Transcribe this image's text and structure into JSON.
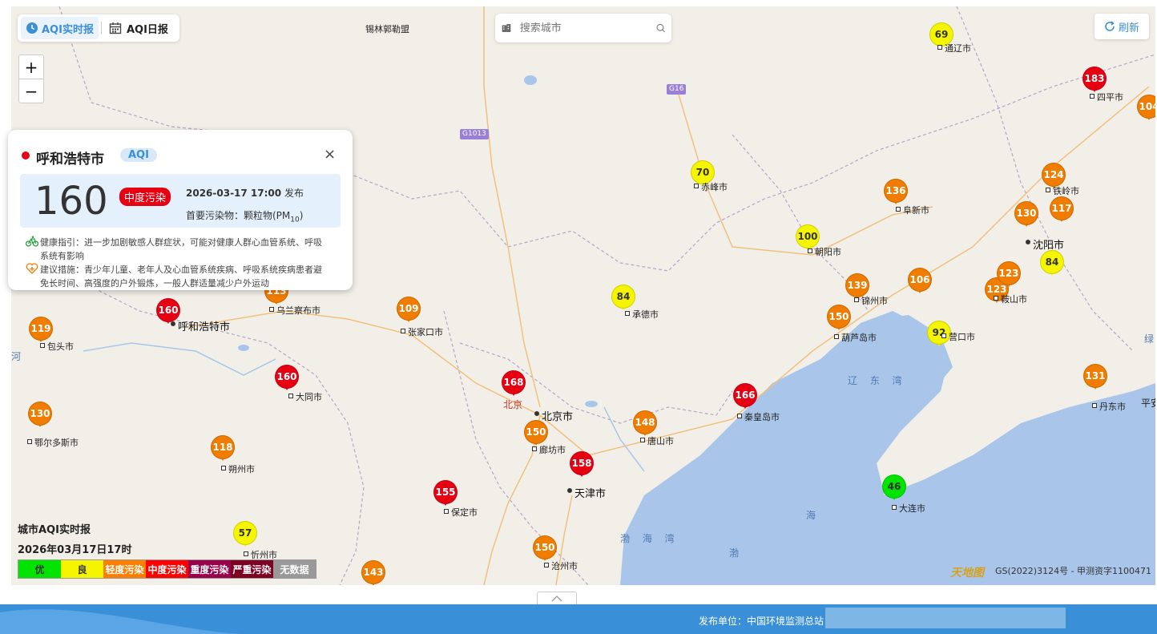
{
  "toolbar": {
    "realtime_tab": "AQI实时报",
    "daily_tab": "AQI日报",
    "search_placeholder": "搜索城市",
    "refresh_label": "刷新",
    "zoom_in": "+",
    "zoom_out": "−"
  },
  "popup": {
    "city": "呼和浩特市",
    "badge": "AQI",
    "close": "×",
    "aqi": "160",
    "level": "中度污染",
    "time": "2026-03-17 17:00",
    "publish_suffix": "发布",
    "pollutant_label": "首要污染物：颗粒物(PM",
    "pollutant_sub": "10",
    "pollutant_tail": ")",
    "health_label": "健康指引：",
    "health_text": "进一步加剧敏感人群症状，可能对健康人群心血管系统、呼吸系统有影响",
    "advice_label": "建议措施：",
    "advice_text": "青少年儿童、老年人及心血管系统疾病、呼吸系统疾病患者避免长时间、高强度的户外锻炼，一般人群适量减少户外运动"
  },
  "markers": [
    {
      "value": "69",
      "color": "#f5f500",
      "text": "#333"
    },
    {
      "value": "183",
      "color": "#e60012",
      "text": "#fff"
    },
    {
      "value": "104",
      "color": "#f07c00",
      "text": "#fff"
    },
    {
      "value": "70",
      "color": "#f5f500",
      "text": "#333"
    },
    {
      "value": "136",
      "color": "#f07c00",
      "text": "#fff"
    },
    {
      "value": "124",
      "color": "#f07c00",
      "text": "#fff"
    },
    {
      "value": "130",
      "color": "#f07c00",
      "text": "#fff"
    },
    {
      "value": "117",
      "color": "#f07c00",
      "text": "#fff"
    },
    {
      "value": "100",
      "color": "#f5f500",
      "text": "#333"
    },
    {
      "value": "84",
      "color": "#f5f500",
      "text": "#333"
    },
    {
      "value": "123",
      "color": "#f07c00",
      "text": "#fff"
    },
    {
      "value": "123",
      "color": "#f07c00",
      "text": "#fff"
    },
    {
      "value": "139",
      "color": "#f07c00",
      "text": "#fff"
    },
    {
      "value": "106",
      "color": "#f07c00",
      "text": "#fff"
    },
    {
      "value": "84",
      "color": "#f5f500",
      "text": "#333"
    },
    {
      "value": "113",
      "color": "#f07c00",
      "text": "#fff"
    },
    {
      "value": "109",
      "color": "#f07c00",
      "text": "#fff"
    },
    {
      "value": "160",
      "color": "#e60012",
      "text": "#fff"
    },
    {
      "value": "119",
      "color": "#f07c00",
      "text": "#fff"
    },
    {
      "value": "150",
      "color": "#f07c00",
      "text": "#fff"
    },
    {
      "value": "92",
      "color": "#f5f500",
      "text": "#333"
    },
    {
      "value": "160",
      "color": "#e60012",
      "text": "#fff"
    },
    {
      "value": "168",
      "color": "#e60012",
      "text": "#fff"
    },
    {
      "value": "166",
      "color": "#e60012",
      "text": "#fff"
    },
    {
      "value": "131",
      "color": "#f07c00",
      "text": "#fff"
    },
    {
      "value": "130",
      "color": "#f07c00",
      "text": "#fff"
    },
    {
      "value": "148",
      "color": "#f07c00",
      "text": "#fff"
    },
    {
      "value": "150",
      "color": "#f07c00",
      "text": "#fff"
    },
    {
      "value": "118",
      "color": "#f07c00",
      "text": "#fff"
    },
    {
      "value": "158",
      "color": "#e60012",
      "text": "#fff"
    },
    {
      "value": "155",
      "color": "#e60012",
      "text": "#fff"
    },
    {
      "value": "46",
      "color": "#00e400",
      "text": "#333"
    },
    {
      "value": "57",
      "color": "#f5f500",
      "text": "#333"
    },
    {
      "value": "150",
      "color": "#f07c00",
      "text": "#fff"
    },
    {
      "value": "143",
      "color": "#f07c00",
      "text": "#fff"
    }
  ],
  "cities": [
    "通辽市",
    "四平市",
    "赤峰市",
    "阜新市",
    "铁岭市",
    "朝阳市",
    "锦州市",
    "鞍山市",
    "乌兰察布市",
    "张家口市",
    "承德市",
    "葫芦岛市",
    "营口市",
    "包头市",
    "大同市",
    "秦皇岛市",
    "丹东市",
    "鄂尔多斯市",
    "廊坊市",
    "唐山市",
    "朔州市",
    "保定市",
    "大连市",
    "忻州市",
    "沧州市"
  ],
  "major_cities": [
    "沈阳市",
    "呼和浩特市",
    "北京市",
    "天津市"
  ],
  "region_labels": [
    "锡林郭勒盟",
    "北京",
    "辽 东 湾",
    "渤 海 湾",
    "海",
    "渤",
    "平安",
    "河",
    "绿"
  ],
  "road_badges": [
    "G16",
    "G1013"
  ],
  "legend": {
    "title": "城市AQI实时报",
    "time": "2026年03月17日17时",
    "levels": [
      {
        "label": "优",
        "color": "#00e400",
        "text": "#333"
      },
      {
        "label": "良",
        "color": "#f5f500",
        "text": "#333"
      },
      {
        "label": "轻度污染",
        "color": "#ff7e00",
        "text": "#fff"
      },
      {
        "label": "中度污染",
        "color": "#ff0000",
        "text": "#fff"
      },
      {
        "label": "重度污染",
        "color": "#99004c",
        "text": "#fff"
      },
      {
        "label": "严重污染",
        "color": "#7e0023",
        "text": "#fff"
      },
      {
        "label": "无数据",
        "color": "#999999",
        "text": "#fff"
      }
    ]
  },
  "copyright": "GS(2022)3124号 - 甲测资字1100471",
  "tdt_logo": "天地图",
  "footer": {
    "publisher": "发布单位：中国环境监测总站"
  }
}
